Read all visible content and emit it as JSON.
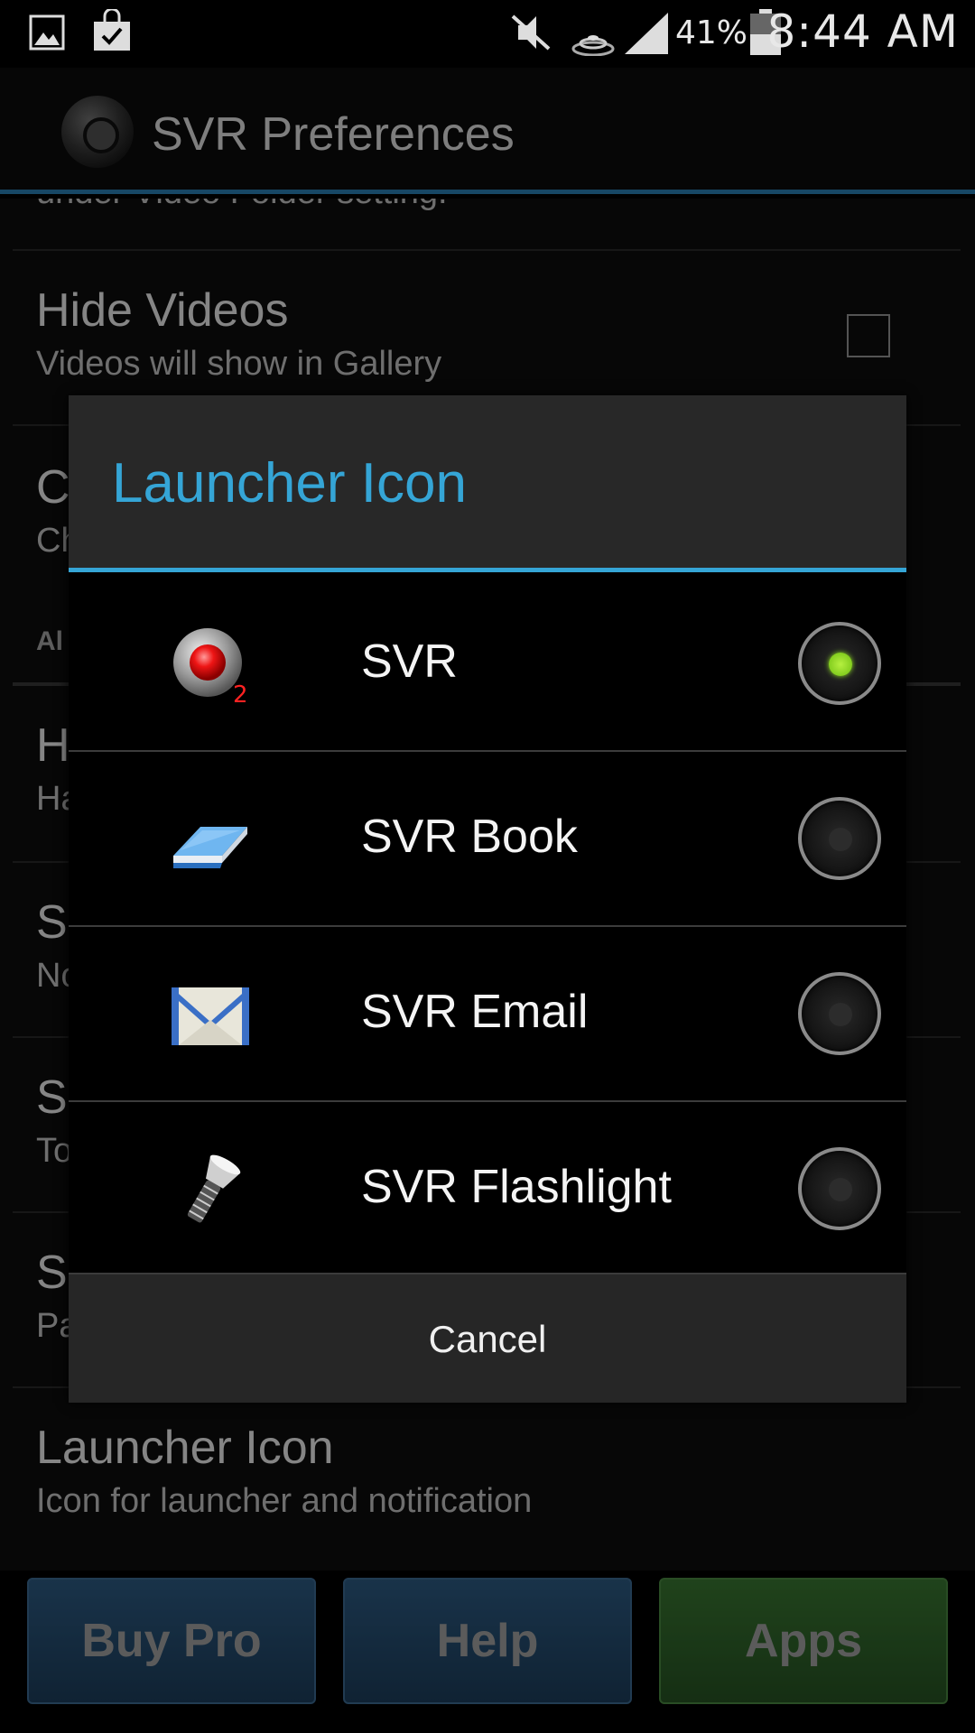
{
  "status_bar": {
    "battery_percent": "41%",
    "time": "8:44 AM",
    "icons": [
      "gallery-icon",
      "shopping-bag-icon",
      "mute-icon",
      "wifi-icon",
      "signal-icon",
      "battery-icon"
    ]
  },
  "app_bar": {
    "title": "SVR Preferences"
  },
  "preferences": {
    "cut_text": "under Video Folder setting.",
    "hide_videos_title": "Hide Videos",
    "hide_videos_summary": "Videos will show in Gallery",
    "hidden_item_1_title": "C",
    "hidden_item_1_summary": "Ch",
    "section_label": "Al",
    "hidden_item_2_title": "H",
    "hidden_item_2_summary": "Ha",
    "hidden_item_3_title": "S",
    "hidden_item_3_summary": "No",
    "hidden_item_4_title": "S",
    "hidden_item_4_summary": "To",
    "hidden_item_5_title": "S",
    "hidden_item_5_summary": "Pa",
    "launcher_icon_title": "Launcher Icon",
    "launcher_icon_summary": "Icon for launcher and notification"
  },
  "bottom_buttons": {
    "buy_pro": "Buy Pro",
    "help": "Help",
    "apps": "Apps"
  },
  "dialog": {
    "title": "Launcher Icon",
    "options": [
      {
        "label": "SVR",
        "icon": "record-icon",
        "selected": true
      },
      {
        "label": "SVR Book",
        "icon": "book-icon",
        "selected": false
      },
      {
        "label": "SVR Email",
        "icon": "email-icon",
        "selected": false
      },
      {
        "label": "SVR Flashlight",
        "icon": "flashlight-icon",
        "selected": false
      }
    ],
    "cancel_label": "Cancel"
  },
  "colors": {
    "accent_blue": "#35a5d6",
    "radio_selected": "#8fe020",
    "buy_pro_bg": "#2e5d86",
    "apps_bg": "#3b7a33"
  }
}
